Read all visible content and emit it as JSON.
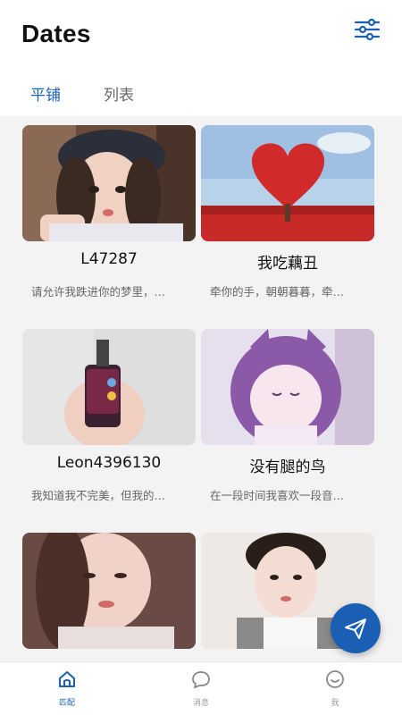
{
  "header": {
    "title": "Dates",
    "filter_icon": "sliders-icon"
  },
  "tabs": [
    {
      "label": "平铺",
      "active": true
    },
    {
      "label": "列表",
      "active": false
    }
  ],
  "cards": [
    {
      "name": "L47287",
      "bio": "请允许我跌进你的梦里，…"
    },
    {
      "name": "我吃藕丑",
      "bio": "牵你的手，朝朝暮暮，牵…"
    },
    {
      "name": "Leon4396130",
      "bio": "我知道我不完美，但我的…"
    },
    {
      "name": "没有腿的鸟",
      "bio": "在一段时间我喜欢一段音…"
    },
    {
      "name": "",
      "bio": ""
    },
    {
      "name": "",
      "bio": ""
    }
  ],
  "fab": {
    "icon": "paper-plane-icon"
  },
  "bottom_nav": [
    {
      "label": "匹配",
      "icon": "home-icon",
      "active": true
    },
    {
      "label": "消息",
      "icon": "chat-bubble-icon",
      "active": false
    },
    {
      "label": "我",
      "icon": "smiley-icon",
      "active": false
    }
  ],
  "colors": {
    "accent": "#1a5fb4",
    "background": "#f3f3f3"
  }
}
